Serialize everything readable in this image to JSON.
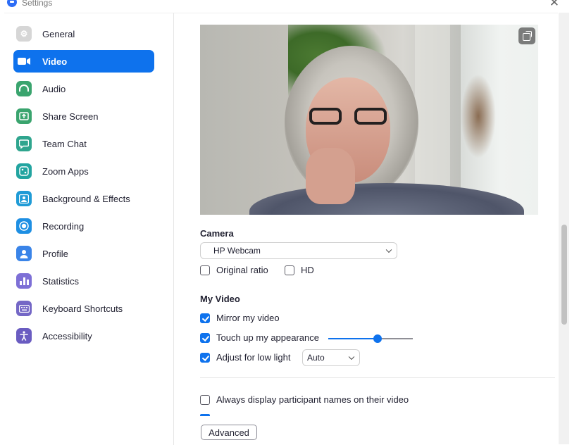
{
  "window": {
    "title": "Settings"
  },
  "sidebar": {
    "items": [
      {
        "label": "General",
        "icon": "gear-icon",
        "color": "#d6d6d6",
        "active": false
      },
      {
        "label": "Video",
        "icon": "video-camera-icon",
        "color": "#ffffff",
        "active": true
      },
      {
        "label": "Audio",
        "icon": "headphones-icon",
        "color": "#3aa46e",
        "active": false
      },
      {
        "label": "Share Screen",
        "icon": "share-screen-icon",
        "color": "#3aa46e",
        "active": false
      },
      {
        "label": "Team Chat",
        "icon": "chat-bubble-icon",
        "color": "#2fa58e",
        "active": false
      },
      {
        "label": "Zoom Apps",
        "icon": "apps-grid-icon",
        "color": "#22a4a0",
        "active": false
      },
      {
        "label": "Background & Effects",
        "icon": "person-background-icon",
        "color": "#1f9bd6",
        "active": false
      },
      {
        "label": "Recording",
        "icon": "record-icon",
        "color": "#1e8fe3",
        "active": false
      },
      {
        "label": "Profile",
        "icon": "profile-person-icon",
        "color": "#3a84e8",
        "active": false
      },
      {
        "label": "Statistics",
        "icon": "bar-chart-icon",
        "color": "#7d6fd6",
        "active": false
      },
      {
        "label": "Keyboard Shortcuts",
        "icon": "keyboard-icon",
        "color": "#7467c6",
        "active": false
      },
      {
        "label": "Accessibility",
        "icon": "accessibility-icon",
        "color": "#6a5cc1",
        "active": false
      }
    ]
  },
  "camera": {
    "heading": "Camera",
    "selected": "HP Webcam",
    "original_ratio": {
      "label": "Original ratio",
      "checked": false
    },
    "hd": {
      "label": "HD",
      "checked": false
    }
  },
  "my_video": {
    "heading": "My Video",
    "mirror": {
      "label": "Mirror my video",
      "checked": true
    },
    "touch_up": {
      "label": "Touch up my appearance",
      "checked": true,
      "level": 0.58
    },
    "low_light": {
      "label": "Adjust for low light",
      "checked": true,
      "mode": "Auto"
    }
  },
  "participants": {
    "names": {
      "label": "Always display participant names on their video",
      "checked": false
    }
  },
  "advanced_button": "Advanced",
  "colors": {
    "accent": "#0e72ed"
  }
}
